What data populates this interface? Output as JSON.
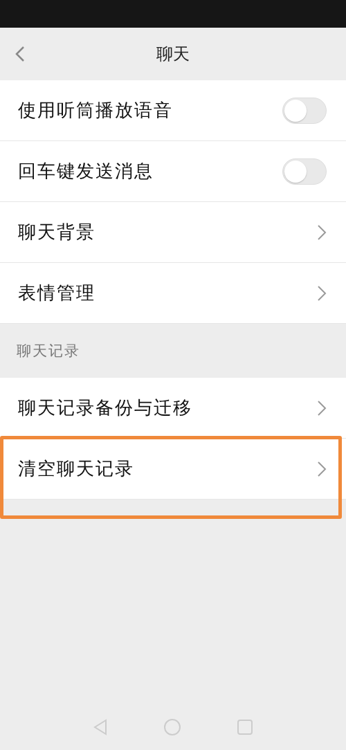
{
  "header": {
    "title": "聊天"
  },
  "settings": [
    {
      "kind": "toggle",
      "label": "使用听筒播放语音",
      "on": false
    },
    {
      "kind": "toggle",
      "label": "回车键发送消息",
      "on": false
    },
    {
      "kind": "link",
      "label": "聊天背景"
    },
    {
      "kind": "link",
      "label": "表情管理"
    }
  ],
  "history_section": {
    "title": "聊天记录",
    "items": [
      {
        "label": "聊天记录备份与迁移",
        "highlighted": false
      },
      {
        "label": "清空聊天记录",
        "highlighted": true
      }
    ]
  }
}
